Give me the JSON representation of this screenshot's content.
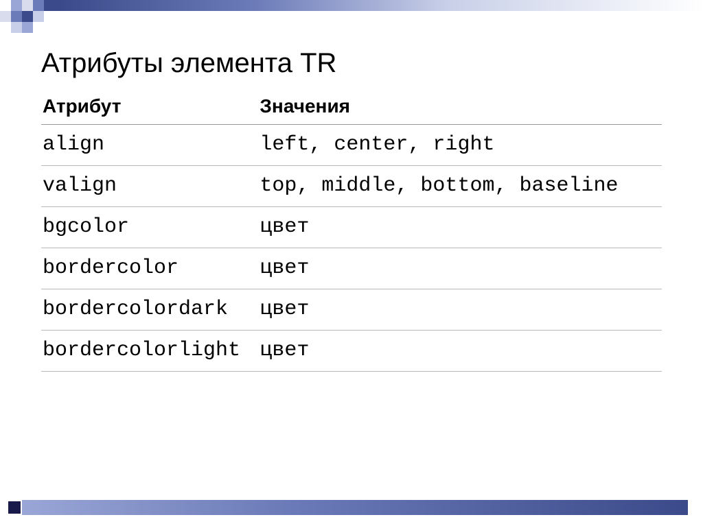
{
  "title": "Атрибуты элемента TR",
  "headers": {
    "col1": "Атрибут",
    "col2": "Значения"
  },
  "rows": [
    {
      "attr": "align",
      "val": "left, center, right"
    },
    {
      "attr": "valign",
      "val": "top, middle, bottom, baseline"
    },
    {
      "attr": "bgcolor",
      "val": "цвет"
    },
    {
      "attr": "bordercolor",
      "val": "цвет"
    },
    {
      "attr": "bordercolordark",
      "val": "цвет"
    },
    {
      "attr": "bordercolorlight",
      "val": "цвет"
    }
  ]
}
